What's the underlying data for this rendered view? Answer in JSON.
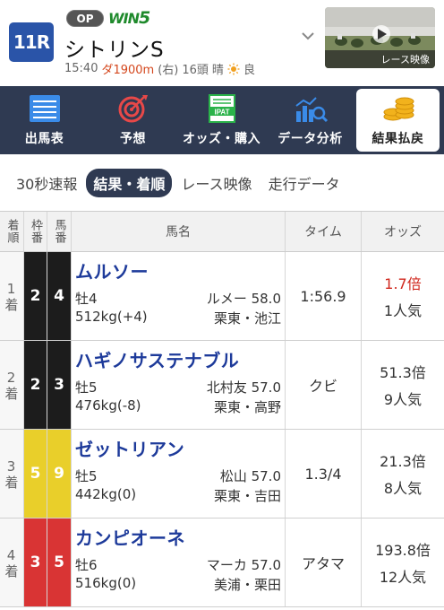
{
  "race": {
    "number": "11R",
    "grade": "OP",
    "win5": "WIN5",
    "name": "シトリンS",
    "time": "15:40",
    "surface": "ダ1900m",
    "direction": "(右)",
    "runners": "16頭",
    "weather": "晴",
    "condition": "良",
    "video_label": "レース映像"
  },
  "nav": {
    "items": [
      {
        "label": "出馬表",
        "icon": "race-card-icon"
      },
      {
        "label": "予想",
        "icon": "target-icon"
      },
      {
        "label": "オッズ・購入",
        "icon": "ipat-icon"
      },
      {
        "label": "データ分析",
        "icon": "analytics-icon"
      },
      {
        "label": "結果払戻",
        "icon": "coins-icon"
      }
    ],
    "active": "結果払戻"
  },
  "tabs": [
    "30秒速報",
    "結果・着順",
    "レース映像",
    "走行データ"
  ],
  "table": {
    "headers": [
      "着順",
      "枠番",
      "馬番",
      "馬名",
      "タイム",
      "オッズ"
    ],
    "rows": [
      {
        "rank": "1着",
        "waku": "2",
        "umaban": "4",
        "name": "ムルソー",
        "sex_age": "牡4",
        "jockey_weight": "ルメー 58.0",
        "weight": "512kg(+4)",
        "trainer": "栗東・池江",
        "time": "1:56.9",
        "odds": "1.7倍",
        "pop": "1人気",
        "waku_color": "#1c1c1c",
        "odds_color": "#d0271d"
      },
      {
        "rank": "2着",
        "waku": "2",
        "umaban": "3",
        "name": "ハギノサステナブル",
        "sex_age": "牡5",
        "jockey_weight": "北村友 57.0",
        "weight": "476kg(-8)",
        "trainer": "栗東・高野",
        "time": "クビ",
        "odds": "51.3倍",
        "pop": "9人気",
        "waku_color": "#1c1c1c",
        "odds_color": "#333333"
      },
      {
        "rank": "3着",
        "waku": "5",
        "umaban": "9",
        "name": "ゼットリアン",
        "sex_age": "牡5",
        "jockey_weight": "松山 57.0",
        "weight": "442kg(0)",
        "trainer": "栗東・吉田",
        "time": "1.3/4",
        "odds": "21.3倍",
        "pop": "8人気",
        "waku_color": "#e9cf2a",
        "odds_color": "#333333"
      },
      {
        "rank": "4着",
        "waku": "3",
        "umaban": "5",
        "name": "カンピオーネ",
        "sex_age": "牡6",
        "jockey_weight": "マーカ 57.0",
        "weight": "516kg(0)",
        "trainer": "美浦・栗田",
        "time": "アタマ",
        "odds": "193.8倍",
        "pop": "12人気",
        "waku_color": "#d93434",
        "odds_color": "#333333"
      }
    ]
  }
}
